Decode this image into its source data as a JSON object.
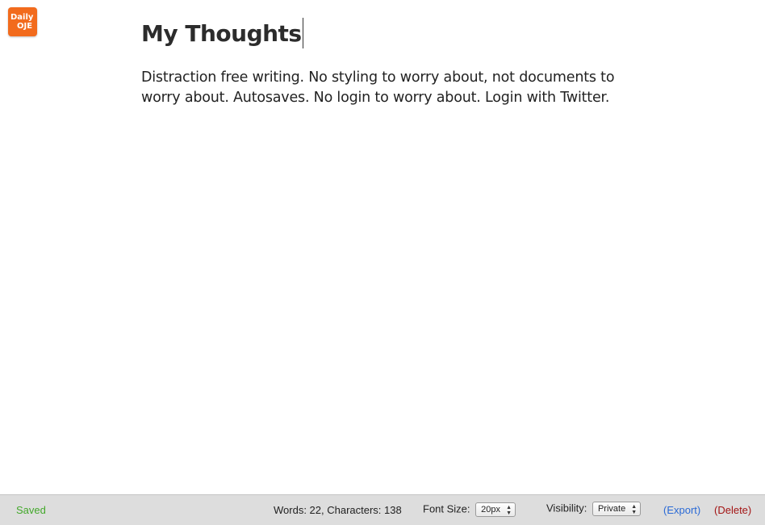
{
  "logo": {
    "line1": "Daily",
    "line2": "OJE"
  },
  "editor": {
    "title": "My Thoughts",
    "body": "Distraction free writing. No styling to worry about, not documents to worry about. Autosaves. No login to worry about. Login with Twitter."
  },
  "footer": {
    "status": "Saved",
    "counts": "Words: 22, Characters: 138",
    "font_size_label": "Font Size:",
    "font_size_value": "20px",
    "visibility_label": "Visibility:",
    "visibility_value": "Private",
    "export_label": "(Export)",
    "delete_label": "(Delete)"
  },
  "colors": {
    "logo_bg": "#f26b1d",
    "saved": "#43a82b",
    "export": "#2a6ad6",
    "delete": "#a31515",
    "footer_bg": "#dddddd"
  }
}
